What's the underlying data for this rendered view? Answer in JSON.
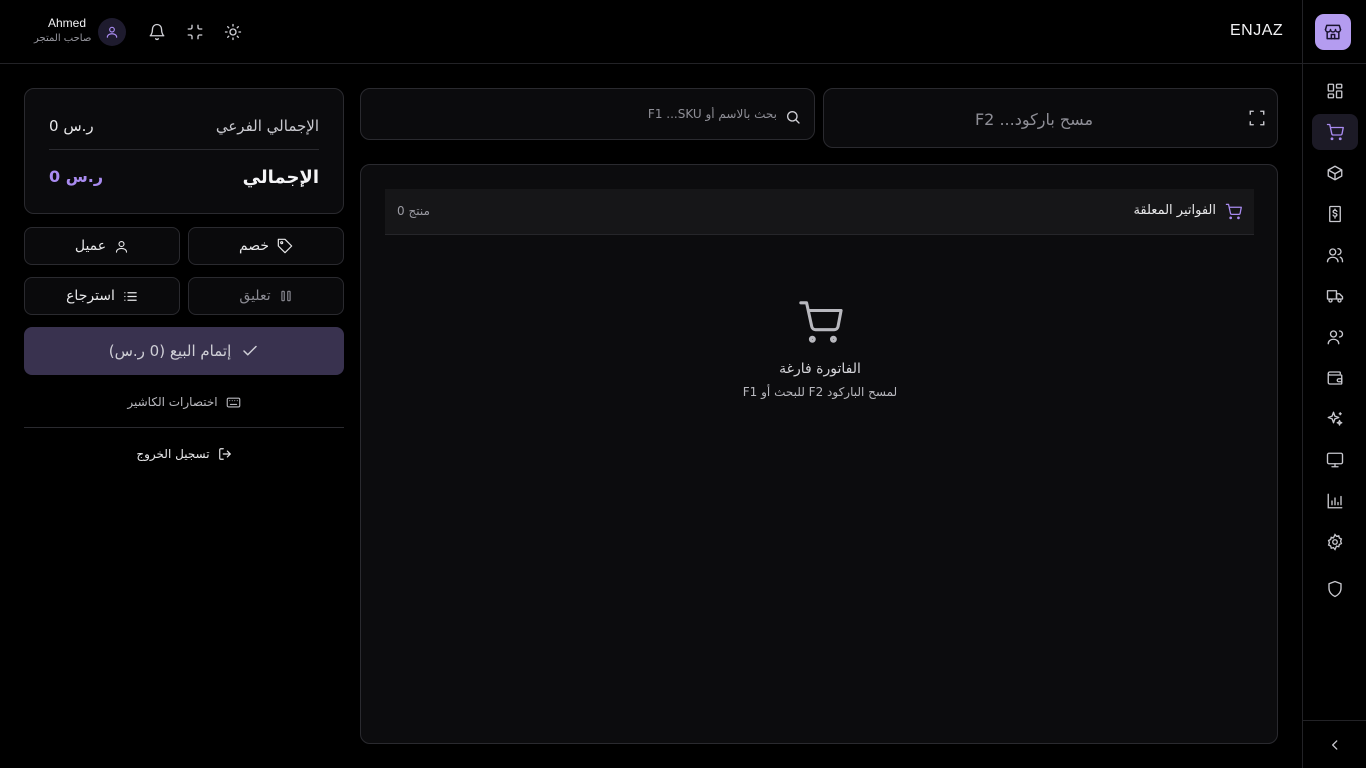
{
  "header": {
    "brand": "ENJAZ",
    "user": {
      "name": "Ahmed",
      "role": "صاحب المتجر"
    },
    "icons": [
      "user-icon",
      "bell-icon",
      "minimize-icon",
      "sun-icon"
    ]
  },
  "sidebar": {
    "logo_icon": "store-icon",
    "items": [
      {
        "icon": "dashboard-icon",
        "active": false
      },
      {
        "icon": "cart-icon",
        "active": true
      },
      {
        "icon": "box-icon",
        "active": false
      },
      {
        "icon": "receipt-dollar-icon",
        "active": false
      },
      {
        "icon": "users-icon",
        "active": false
      },
      {
        "icon": "truck-icon",
        "active": false
      },
      {
        "icon": "team-icon",
        "active": false
      },
      {
        "icon": "wallet-icon",
        "active": false
      },
      {
        "icon": "sparkles-icon",
        "active": false
      },
      {
        "icon": "monitor-icon",
        "active": false
      },
      {
        "icon": "bar-chart-icon",
        "active": false
      },
      {
        "icon": "settings-icon",
        "active": false
      },
      {
        "icon": "shield-icon",
        "active": false
      }
    ],
    "collapse_icon": "chevron-left-icon"
  },
  "totals": {
    "subtotal_label": "الإجمالي الفرعي",
    "subtotal_value": "0 ر.س",
    "total_label": "الإجمالي",
    "total_value": "0 ر.س"
  },
  "actions": {
    "discount": "خصم",
    "customer": "عميل",
    "hold": "تعليق",
    "return": "استرجاع",
    "checkout": "إتمام البيع (0 ر.س)",
    "shortcuts": "اختصارات الكاشير",
    "logout": "تسجيل الخروج"
  },
  "search": {
    "placeholder": "بحث بالاسم أو F1 ...SKU",
    "value": ""
  },
  "barcode": {
    "placeholder": "مسح باركود... F2",
    "value": ""
  },
  "invoice": {
    "pending_label": "الفواتير المعلقة",
    "item_count": "0 منتج",
    "empty_title": "الفاتورة فارغة",
    "empty_hint": "F1 للبحث أو F2 لمسح الباركود"
  },
  "colors": {
    "accent": "#a98bf0",
    "logo_bg": "#b49cf0",
    "checkout_bg": "#39324f",
    "background": "#000000"
  }
}
